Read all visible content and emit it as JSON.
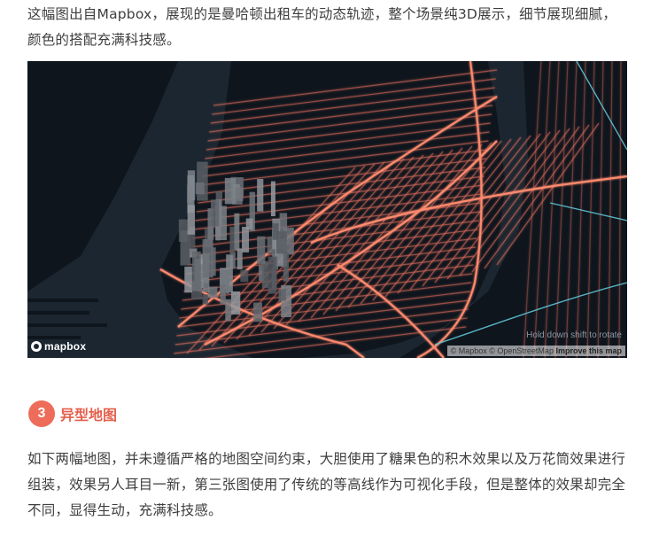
{
  "article": {
    "intro": "这幅图出自Mapbox，展现的是曼哈顿出租车的动态轨迹，整个场景纯3D展示，细节展现细腻，颜色的搭配充满科技感。",
    "map": {
      "logo_text": "mapbox",
      "hint": "Hold down shift to rotate",
      "attribution": "© Mapbox © OpenStreetMap",
      "improve_link": "Improve this map",
      "colors": {
        "water": "#1b2630",
        "land": "#0f1720",
        "trail": "#e8705d",
        "trail_alt": "#5fc3d4"
      }
    },
    "section": {
      "number": "3",
      "title": "异型地图",
      "color": "#ed6c5a"
    },
    "body": "如下两幅地图，并未遵循严格的地图空间约束，大胆使用了糖果色的积木效果以及万花筒效果进行组装，效果另人耳目一新，第三张图使用了传统的等高线作为可视化手段，但是整体的效果却完全不同，显得生动，充满科技感。"
  }
}
